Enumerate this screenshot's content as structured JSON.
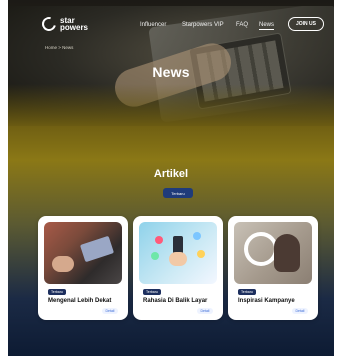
{
  "brand": {
    "logo_text_top": "star",
    "logo_text_bottom": "powers"
  },
  "nav": {
    "items": [
      {
        "label": "Influencer"
      },
      {
        "label": "Starpowers VIP"
      },
      {
        "label": "FAQ"
      },
      {
        "label": "News"
      }
    ],
    "cta_label": "JOIN US"
  },
  "hero": {
    "breadcrumb": "Home > News",
    "title": "News"
  },
  "section": {
    "title": "Artikel",
    "tag": "Terbaru"
  },
  "articles": [
    {
      "title": "Mengenal Lebih Dekat",
      "tag": "Terbaru",
      "button": "Detail"
    },
    {
      "title": "Rahasia Di Balik Layar",
      "tag": "Terbaru",
      "button": "Detail"
    },
    {
      "title": "Inspirasi Kampanye",
      "tag": "Terbaru",
      "button": "Detail"
    }
  ]
}
